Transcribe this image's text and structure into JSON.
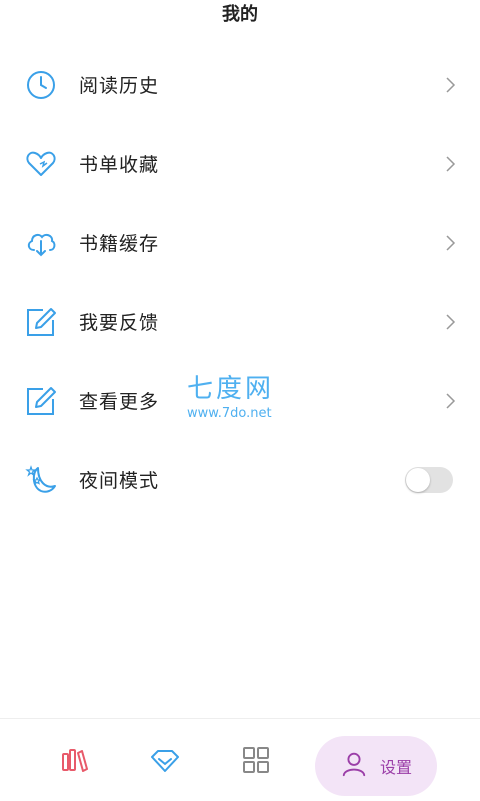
{
  "header": {
    "title": "我的"
  },
  "menu": [
    {
      "label": "阅读历史",
      "icon": "clock-icon"
    },
    {
      "label": "书单收藏",
      "icon": "heart-icon"
    },
    {
      "label": "书籍缓存",
      "icon": "cloud-download-icon"
    },
    {
      "label": "我要反馈",
      "icon": "edit-icon"
    },
    {
      "label": "查看更多",
      "icon": "edit-icon"
    }
  ],
  "night_mode": {
    "label": "夜间模式",
    "icon": "moon-stars-icon",
    "enabled": false
  },
  "watermark": {
    "title": "七度网",
    "url": "www.7do.net"
  },
  "tabs": [
    {
      "icon": "bookshelf-icon"
    },
    {
      "icon": "diamond-icon"
    },
    {
      "icon": "grid-icon"
    },
    {
      "icon": "person-icon",
      "label": "设置",
      "active": true
    }
  ],
  "colors": {
    "accent": "#3aa0e8",
    "tab_active_bg": "#f3e4f7",
    "tab_active_fg": "#9b3ea8",
    "bookshelf": "#e85a6a"
  }
}
